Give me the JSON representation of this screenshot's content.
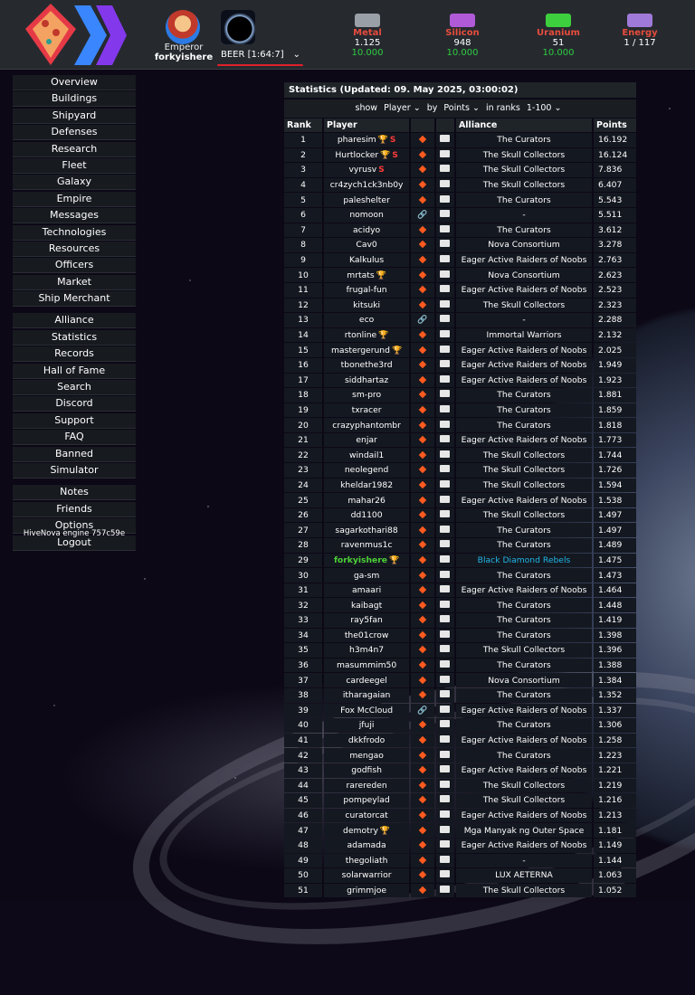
{
  "header": {
    "rank_title": "Emperor",
    "player_name": "forkyishere",
    "planet": "BEER [1:64:7]",
    "resources": [
      {
        "name": "Metal",
        "amount": "1.125",
        "production": "10.000",
        "color": "#9aa0a8"
      },
      {
        "name": "Silicon",
        "amount": "948",
        "production": "10.000",
        "color": "#b05ad8"
      },
      {
        "name": "Uranium",
        "amount": "51",
        "production": "10.000",
        "color": "#3ecf3e"
      },
      {
        "name": "Energy",
        "amount": "1 / 117",
        "production": "",
        "color": "#a07ad8"
      }
    ]
  },
  "menu": {
    "group1": [
      "Overview",
      "Buildings",
      "Shipyard",
      "Defenses",
      "Research",
      "Fleet",
      "Galaxy",
      "Empire",
      "Messages",
      "Technologies",
      "Resources",
      "Officers",
      "Market",
      "Ship Merchant"
    ],
    "group2": [
      "Alliance",
      "Statistics",
      "Records",
      "Hall of Fame",
      "Search",
      "Discord",
      "Support",
      "FAQ",
      "Banned",
      "Simulator"
    ],
    "group3": [
      "Notes",
      "Friends",
      "Options",
      "Logout"
    ],
    "engine": "HiveNova engine 757c59e"
  },
  "stats": {
    "title": "Statistics (Updated: 09. May 2025, 03:00:02)",
    "filter": {
      "show_label": "show",
      "show_value": "Player",
      "by_label": "by",
      "by_value": "Points",
      "ranks_label": "in ranks",
      "ranks_value": "1-100"
    },
    "columns": {
      "rank": "Rank",
      "player": "Player",
      "alliance": "Alliance",
      "points": "Points"
    },
    "rows": [
      {
        "rank": "1",
        "player": "pharesim",
        "trophy": true,
        "s": true,
        "alliance": "The Curators",
        "points": "16.192"
      },
      {
        "rank": "2",
        "player": "Hurtlocker",
        "trophy": true,
        "s": true,
        "alliance": "The Skull Collectors",
        "points": "16.124"
      },
      {
        "rank": "3",
        "player": "vyrusv",
        "s": true,
        "alliance": "The Skull Collectors",
        "points": "7.836"
      },
      {
        "rank": "4",
        "player": "cr4zych1ck3nb0y",
        "alliance": "The Skull Collectors",
        "points": "6.407"
      },
      {
        "rank": "5",
        "player": "paleshelter",
        "alliance": "The Curators",
        "points": "5.543"
      },
      {
        "rank": "6",
        "player": "nomoon",
        "link": true,
        "alliance": "-",
        "points": "5.511"
      },
      {
        "rank": "7",
        "player": "acidyo",
        "alliance": "The Curators",
        "points": "3.612"
      },
      {
        "rank": "8",
        "player": "Cav0",
        "alliance": "Nova Consortium",
        "points": "3.278"
      },
      {
        "rank": "9",
        "player": "Kalkulus",
        "alliance": "Eager Active Raiders of Noobs",
        "points": "2.763"
      },
      {
        "rank": "10",
        "player": "mrtats",
        "trophy": true,
        "alliance": "Nova Consortium",
        "points": "2.623"
      },
      {
        "rank": "11",
        "player": "frugal-fun",
        "alliance": "Eager Active Raiders of Noobs",
        "points": "2.523"
      },
      {
        "rank": "12",
        "player": "kitsuki",
        "alliance": "The Skull Collectors",
        "points": "2.323"
      },
      {
        "rank": "13",
        "player": "eco",
        "link": true,
        "alliance": "-",
        "points": "2.288"
      },
      {
        "rank": "14",
        "player": "rtonline",
        "trophy": true,
        "alliance": "Immortal Warriors",
        "points": "2.132"
      },
      {
        "rank": "15",
        "player": "mastergerund",
        "trophy": true,
        "alliance": "Eager Active Raiders of Noobs",
        "points": "2.025"
      },
      {
        "rank": "16",
        "player": "tbonethe3rd",
        "alliance": "Eager Active Raiders of Noobs",
        "points": "1.949"
      },
      {
        "rank": "17",
        "player": "siddhartaz",
        "alliance": "Eager Active Raiders of Noobs",
        "points": "1.923"
      },
      {
        "rank": "18",
        "player": "sm-pro",
        "alliance": "The Curators",
        "points": "1.881"
      },
      {
        "rank": "19",
        "player": "txracer",
        "alliance": "The Curators",
        "points": "1.859"
      },
      {
        "rank": "20",
        "player": "crazyphantombr",
        "alliance": "The Curators",
        "points": "1.818"
      },
      {
        "rank": "21",
        "player": "enjar",
        "alliance": "Eager Active Raiders of Noobs",
        "points": "1.773"
      },
      {
        "rank": "22",
        "player": "windail1",
        "alliance": "The Skull Collectors",
        "points": "1.744"
      },
      {
        "rank": "23",
        "player": "neolegend",
        "alliance": "The Skull Collectors",
        "points": "1.726"
      },
      {
        "rank": "24",
        "player": "kheldar1982",
        "alliance": "The Skull Collectors",
        "points": "1.594"
      },
      {
        "rank": "25",
        "player": "mahar26",
        "alliance": "Eager Active Raiders of Noobs",
        "points": "1.538"
      },
      {
        "rank": "26",
        "player": "dd1100",
        "alliance": "The Skull Collectors",
        "points": "1.497"
      },
      {
        "rank": "27",
        "player": "sagarkothari88",
        "alliance": "The Curators",
        "points": "1.497"
      },
      {
        "rank": "28",
        "player": "ravenmus1c",
        "alliance": "The Curators",
        "points": "1.489"
      },
      {
        "rank": "29",
        "player": "forkyishere",
        "trophy": true,
        "me": true,
        "alliance": "Black Diamond Rebels",
        "points": "1.475"
      },
      {
        "rank": "30",
        "player": "ga-sm",
        "alliance": "The Curators",
        "points": "1.473"
      },
      {
        "rank": "31",
        "player": "amaari",
        "alliance": "Eager Active Raiders of Noobs",
        "points": "1.464"
      },
      {
        "rank": "32",
        "player": "kaibagt",
        "alliance": "The Curators",
        "points": "1.448"
      },
      {
        "rank": "33",
        "player": "ray5fan",
        "alliance": "The Curators",
        "points": "1.419"
      },
      {
        "rank": "34",
        "player": "the01crow",
        "alliance": "The Curators",
        "points": "1.398"
      },
      {
        "rank": "35",
        "player": "h3m4n7",
        "alliance": "The Skull Collectors",
        "points": "1.396"
      },
      {
        "rank": "36",
        "player": "masummim50",
        "alliance": "The Curators",
        "points": "1.388"
      },
      {
        "rank": "37",
        "player": "cardeegel",
        "alliance": "Nova Consortium",
        "points": "1.384"
      },
      {
        "rank": "38",
        "player": "itharagaian",
        "alliance": "The Curators",
        "points": "1.352"
      },
      {
        "rank": "39",
        "player": "Fox McCloud",
        "link": true,
        "alliance": "Eager Active Raiders of Noobs",
        "points": "1.337"
      },
      {
        "rank": "40",
        "player": "jfuji",
        "alliance": "The Curators",
        "points": "1.306"
      },
      {
        "rank": "41",
        "player": "dkkfrodo",
        "alliance": "Eager Active Raiders of Noobs",
        "points": "1.258"
      },
      {
        "rank": "42",
        "player": "mengao",
        "alliance": "The Curators",
        "points": "1.223"
      },
      {
        "rank": "43",
        "player": "godfish",
        "alliance": "Eager Active Raiders of Noobs",
        "points": "1.221"
      },
      {
        "rank": "44",
        "player": "rarereden",
        "alliance": "The Skull Collectors",
        "points": "1.219"
      },
      {
        "rank": "45",
        "player": "pompeylad",
        "alliance": "The Skull Collectors",
        "points": "1.216"
      },
      {
        "rank": "46",
        "player": "curatorcat",
        "alliance": "Eager Active Raiders of Noobs",
        "points": "1.213"
      },
      {
        "rank": "47",
        "player": "demotry",
        "trophy": true,
        "alliance": "Mga Manyak ng Outer Space",
        "points": "1.181"
      },
      {
        "rank": "48",
        "player": "adamada",
        "alliance": "Eager Active Raiders of Noobs",
        "points": "1.149"
      },
      {
        "rank": "49",
        "player": "thegoliath",
        "alliance": "-",
        "points": "1.144"
      },
      {
        "rank": "50",
        "player": "solarwarrior",
        "alliance": "LUX AETERNA",
        "points": "1.063"
      },
      {
        "rank": "51",
        "player": "grimmjoe",
        "alliance": "The Skull Collectors",
        "points": "1.052"
      }
    ]
  }
}
